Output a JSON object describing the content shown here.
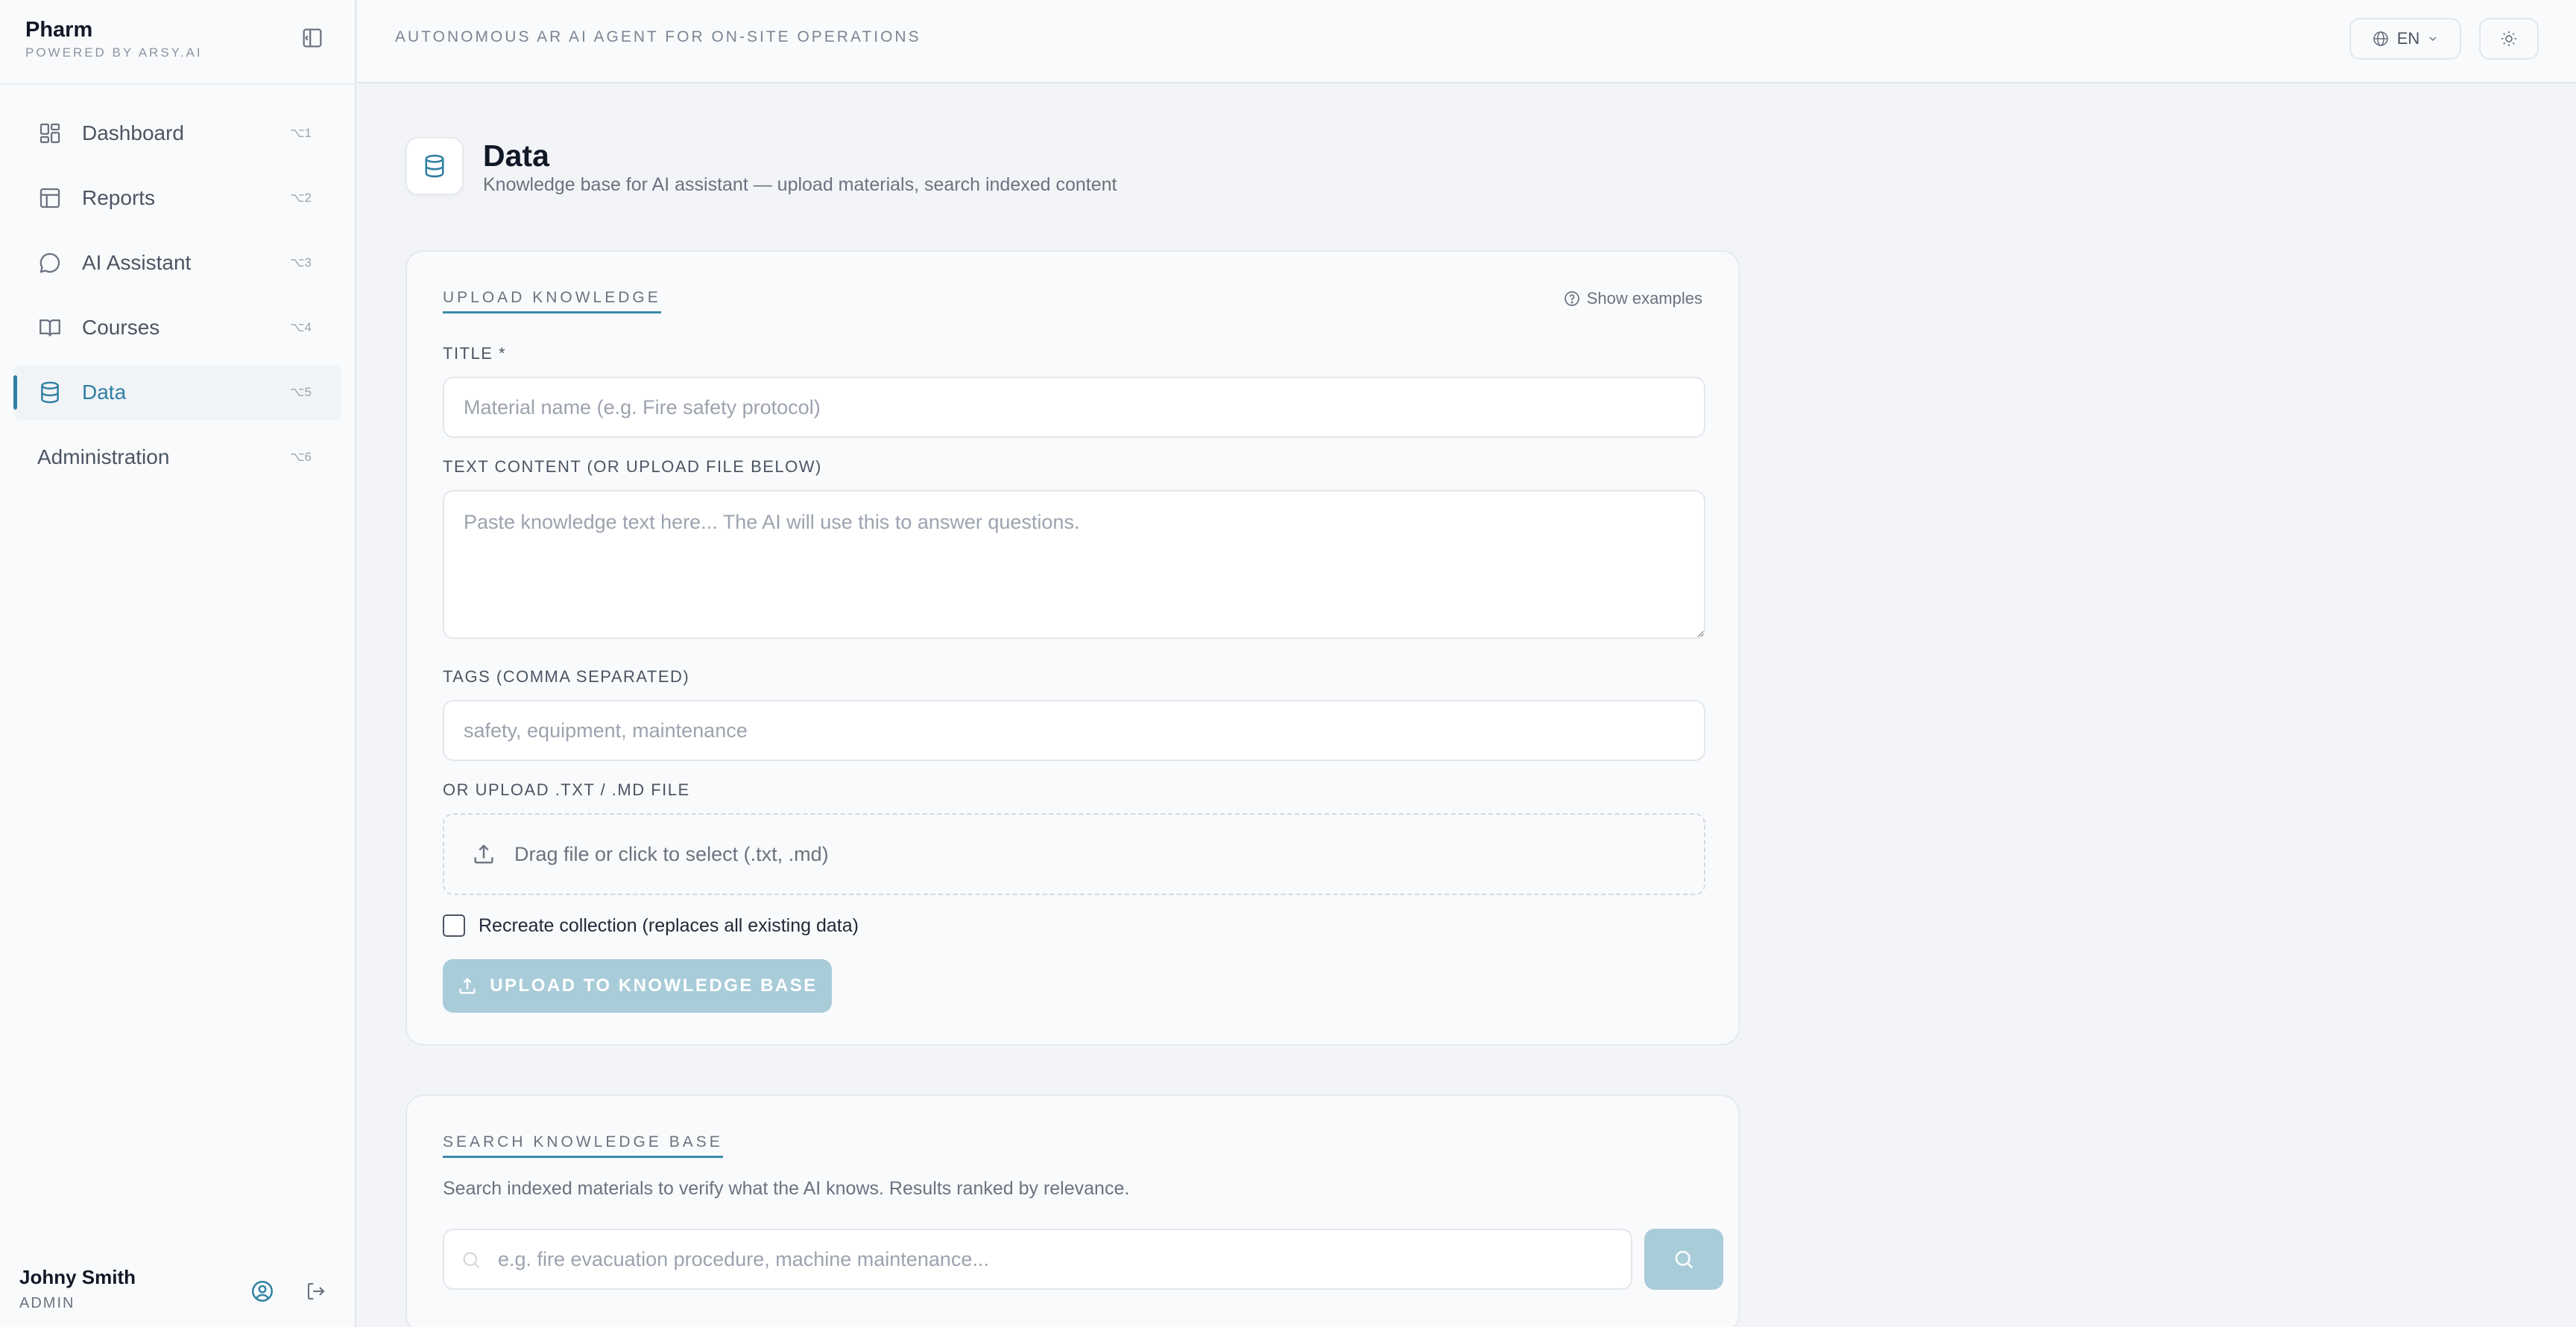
{
  "brand": {
    "name": "Pharm",
    "subtitle": "POWERED BY ARSY.AI"
  },
  "header": {
    "tagline": "AUTONOMOUS AR AI AGENT FOR ON-SITE OPERATIONS",
    "language": "EN"
  },
  "sidebar": {
    "items": [
      {
        "label": "Dashboard",
        "shortcut": "⌥1",
        "icon": "dashboard-icon"
      },
      {
        "label": "Reports",
        "shortcut": "⌥2",
        "icon": "table-icon"
      },
      {
        "label": "AI Assistant",
        "shortcut": "⌥3",
        "icon": "chat-bubble-icon"
      },
      {
        "label": "Courses",
        "shortcut": "⌥4",
        "icon": "book-icon"
      },
      {
        "label": "Data",
        "shortcut": "⌥5",
        "icon": "database-icon",
        "active": true
      },
      {
        "label": "Administration",
        "shortcut": "⌥6"
      }
    ]
  },
  "user": {
    "name": "Johny Smith",
    "role": "ADMIN"
  },
  "page": {
    "title": "Data",
    "subtitle": "Knowledge base for AI assistant — upload materials, search indexed content"
  },
  "upload": {
    "section_title": "UPLOAD KNOWLEDGE",
    "examples_label": "Show examples",
    "title_label": "TITLE *",
    "title_placeholder": "Material name (e.g. Fire safety protocol)",
    "content_label": "TEXT CONTENT (OR UPLOAD FILE BELOW)",
    "content_placeholder": "Paste knowledge text here... The AI will use this to answer questions.",
    "tags_label": "TAGS (COMMA SEPARATED)",
    "tags_placeholder": "safety, equipment, maintenance",
    "file_label": "OR UPLOAD .TXT / .MD FILE",
    "dropzone_text": "Drag file or click to select (.txt, .md)",
    "recreate_label": "Recreate collection (replaces all existing data)",
    "button_label": "UPLOAD TO KNOWLEDGE BASE"
  },
  "search": {
    "section_title": "SEARCH KNOWLEDGE BASE",
    "description": "Search indexed materials to verify what the AI knows. Results ranked by relevance.",
    "placeholder": "e.g. fire evacuation procedure, machine maintenance..."
  },
  "colors": {
    "accent": "#2f7fa3",
    "button_disabled": "#a9ccd9"
  }
}
